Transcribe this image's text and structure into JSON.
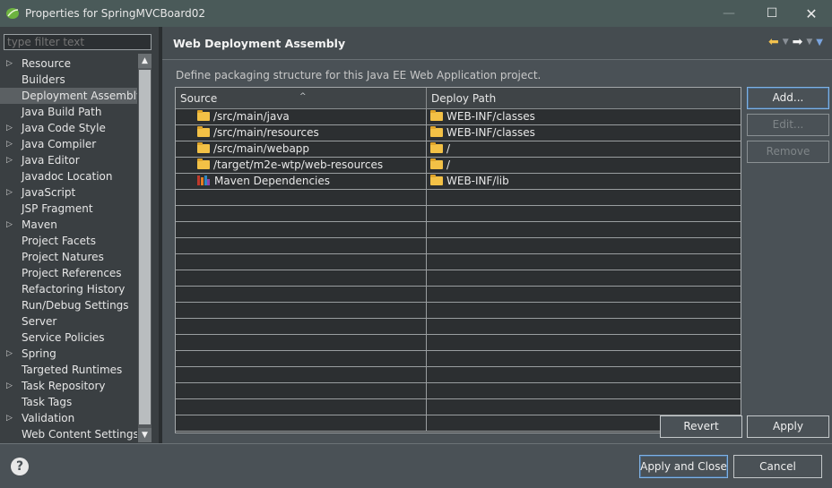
{
  "window": {
    "title": "Properties for SpringMVCBoard02",
    "minimize": "—",
    "maximize": "☐",
    "close": "✕"
  },
  "filter": {
    "placeholder": "type filter text"
  },
  "tree": {
    "items": [
      {
        "label": "Resource",
        "expandable": true
      },
      {
        "label": "Builders",
        "expandable": false
      },
      {
        "label": "Deployment Assembly",
        "expandable": false,
        "selected": true
      },
      {
        "label": "Java Build Path",
        "expandable": false
      },
      {
        "label": "Java Code Style",
        "expandable": true
      },
      {
        "label": "Java Compiler",
        "expandable": true
      },
      {
        "label": "Java Editor",
        "expandable": true
      },
      {
        "label": "Javadoc Location",
        "expandable": false
      },
      {
        "label": "JavaScript",
        "expandable": true
      },
      {
        "label": "JSP Fragment",
        "expandable": false
      },
      {
        "label": "Maven",
        "expandable": true
      },
      {
        "label": "Project Facets",
        "expandable": false
      },
      {
        "label": "Project Natures",
        "expandable": false
      },
      {
        "label": "Project References",
        "expandable": false
      },
      {
        "label": "Refactoring History",
        "expandable": false
      },
      {
        "label": "Run/Debug Settings",
        "expandable": false
      },
      {
        "label": "Server",
        "expandable": false
      },
      {
        "label": "Service Policies",
        "expandable": false
      },
      {
        "label": "Spring",
        "expandable": true
      },
      {
        "label": "Targeted Runtimes",
        "expandable": false
      },
      {
        "label": "Task Repository",
        "expandable": true
      },
      {
        "label": "Task Tags",
        "expandable": false
      },
      {
        "label": "Validation",
        "expandable": true
      },
      {
        "label": "Web Content Settings",
        "expandable": false
      }
    ]
  },
  "page": {
    "title": "Web Deployment Assembly",
    "description": "Define packaging structure for this Java EE Web Application project."
  },
  "table": {
    "columns": {
      "source": "Source",
      "deploy": "Deploy Path"
    },
    "rows": [
      {
        "source": "/src/main/java",
        "deploy": "WEB-INF/classes",
        "icon": "folder-icon"
      },
      {
        "source": "/src/main/resources",
        "deploy": "WEB-INF/classes",
        "icon": "folder-icon"
      },
      {
        "source": "/src/main/webapp",
        "deploy": "/",
        "icon": "folder-icon"
      },
      {
        "source": "/target/m2e-wtp/web-resources",
        "deploy": "/",
        "icon": "folder-icon"
      },
      {
        "source": "Maven Dependencies",
        "deploy": "WEB-INF/lib",
        "icon": "library-icon"
      }
    ]
  },
  "buttons": {
    "add": "Add...",
    "edit": "Edit...",
    "remove": "Remove",
    "revert": "Revert",
    "apply": "Apply",
    "apply_and_close": "Apply and Close",
    "cancel": "Cancel"
  },
  "help": "?",
  "colors": {
    "accent_folder": "#f3c146",
    "focus_border": "#7fb2e5",
    "selection": "#5b6063"
  }
}
